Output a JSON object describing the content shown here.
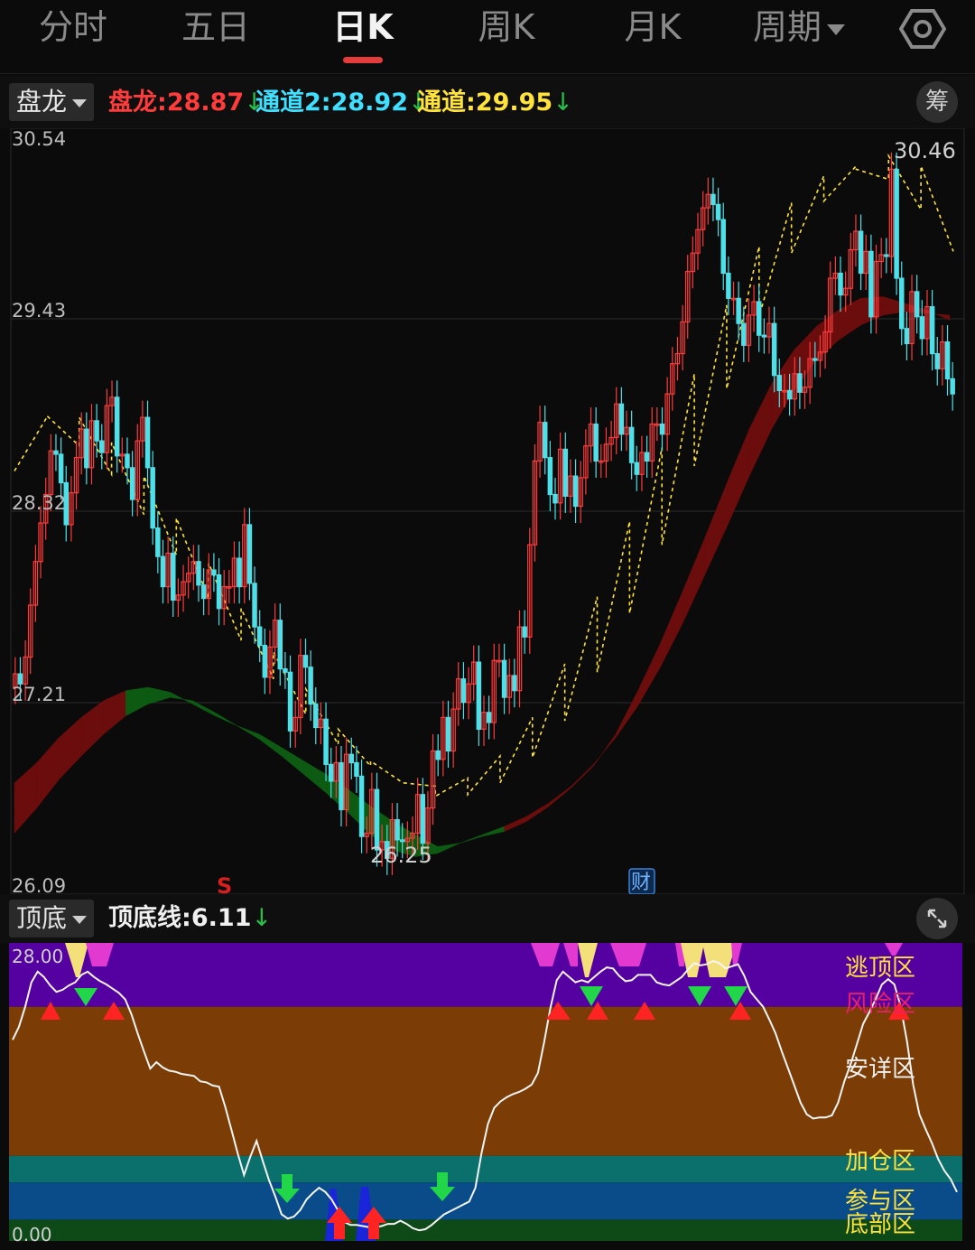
{
  "tabs": [
    {
      "label": "分时",
      "active": false
    },
    {
      "label": "五日",
      "active": false
    },
    {
      "label": "日K",
      "active": true
    },
    {
      "label": "周K",
      "active": false
    },
    {
      "label": "月K",
      "active": false
    },
    {
      "label": "周期",
      "active": false,
      "dropdown": true
    }
  ],
  "settings_icon": "gear-icon",
  "main_indicator": {
    "selector_label": "盘龙",
    "legend": [
      {
        "label": "盘龙:",
        "value": "28.87",
        "color": "#ff3b3b"
      },
      {
        "label": "通道2:",
        "value": "28.92",
        "color": "#3fe0ff"
      },
      {
        "label": "通道:",
        "value": "29.95",
        "color": "#ffe23a"
      }
    ],
    "trend_symbol": "↓",
    "chip_button": "筹"
  },
  "chart_data": [
    {
      "type": "candlestick",
      "y_ticks": [
        "30.54",
        "29.43",
        "28.32",
        "27.21",
        "26.09"
      ],
      "ylim": [
        26.09,
        30.54
      ],
      "annotations": {
        "high": "30.46",
        "low": "26.25",
        "signal": "S",
        "event": "财"
      },
      "colors": {
        "up": "#ff3b3b",
        "down": "#4ee0e8",
        "band_up": "#6b0d0d",
        "band_down": "#0d5a12",
        "ma": "#ffe23a"
      },
      "candles": [
        [
          27.27,
          27.35
        ],
        [
          27.35,
          27.29
        ],
        [
          27.29,
          27.45
        ],
        [
          27.45,
          27.76
        ],
        [
          27.76,
          28.02
        ],
        [
          28.02,
          28.25
        ],
        [
          28.25,
          28.42
        ],
        [
          28.42,
          28.68
        ],
        [
          28.68,
          28.66
        ],
        [
          28.66,
          28.49
        ],
        [
          28.49,
          28.24
        ],
        [
          28.24,
          28.43
        ],
        [
          28.43,
          28.64
        ],
        [
          28.64,
          28.81
        ],
        [
          28.81,
          28.58
        ],
        [
          28.58,
          28.86
        ],
        [
          28.86,
          28.74
        ],
        [
          28.74,
          28.67
        ],
        [
          28.67,
          28.95
        ],
        [
          28.95,
          29.0
        ],
        [
          29.0,
          28.65
        ],
        [
          28.65,
          28.66
        ],
        [
          28.66,
          28.58
        ],
        [
          28.58,
          28.39
        ],
        [
          28.39,
          28.74
        ],
        [
          28.74,
          28.88
        ],
        [
          28.88,
          28.58
        ],
        [
          28.58,
          28.22
        ],
        [
          28.22,
          28.05
        ],
        [
          28.05,
          27.87
        ],
        [
          27.87,
          28.07
        ],
        [
          28.07,
          27.79
        ],
        [
          27.79,
          27.82
        ],
        [
          27.82,
          27.9
        ],
        [
          27.9,
          27.95
        ],
        [
          27.95,
          28.02
        ],
        [
          28.02,
          27.88
        ],
        [
          27.88,
          27.8
        ],
        [
          27.8,
          27.97
        ],
        [
          27.97,
          27.94
        ],
        [
          27.94,
          27.74
        ],
        [
          27.74,
          27.87
        ],
        [
          27.87,
          27.87
        ],
        [
          27.87,
          28.04
        ],
        [
          28.04,
          27.87
        ],
        [
          27.87,
          28.24
        ],
        [
          28.24,
          27.89
        ],
        [
          27.89,
          27.63
        ],
        [
          27.63,
          27.52
        ],
        [
          27.52,
          27.33
        ],
        [
          27.33,
          27.51
        ],
        [
          27.51,
          27.67
        ],
        [
          27.67,
          27.38
        ],
        [
          27.38,
          27.36
        ],
        [
          27.36,
          27.01
        ],
        [
          27.01,
          27.09
        ],
        [
          27.09,
          27.46
        ],
        [
          27.46,
          27.39
        ],
        [
          27.39,
          27.17
        ],
        [
          27.17,
          27.03
        ],
        [
          27.03,
          27.08
        ],
        [
          27.08,
          26.81
        ],
        [
          26.81,
          26.71
        ],
        [
          26.71,
          26.82
        ],
        [
          26.82,
          26.54
        ],
        [
          26.54,
          26.87
        ],
        [
          26.87,
          26.82
        ],
        [
          26.82,
          26.74
        ],
        [
          26.74,
          26.38
        ],
        [
          26.38,
          26.4
        ],
        [
          26.4,
          26.66
        ],
        [
          26.66,
          26.3
        ],
        [
          26.3,
          26.35
        ],
        [
          26.35,
          26.25
        ],
        [
          26.25,
          26.48
        ],
        [
          26.48,
          26.36
        ],
        [
          26.36,
          26.35
        ],
        [
          26.35,
          26.37
        ],
        [
          26.37,
          26.4
        ],
        [
          26.4,
          26.63
        ],
        [
          26.63,
          26.34
        ],
        [
          26.34,
          26.55
        ],
        [
          26.55,
          26.89
        ],
        [
          26.89,
          26.84
        ],
        [
          26.84,
          27.09
        ],
        [
          27.09,
          26.89
        ],
        [
          26.89,
          27.14
        ],
        [
          27.14,
          27.32
        ],
        [
          27.32,
          27.18
        ],
        [
          27.18,
          27.29
        ],
        [
          27.29,
          27.42
        ],
        [
          27.42,
          27.02
        ],
        [
          27.02,
          27.12
        ],
        [
          27.12,
          27.06
        ],
        [
          27.06,
          27.43
        ],
        [
          27.43,
          27.43
        ],
        [
          27.43,
          27.21
        ],
        [
          27.21,
          27.34
        ],
        [
          27.34,
          27.25
        ],
        [
          27.25,
          27.63
        ],
        [
          27.63,
          27.57
        ],
        [
          27.57,
          28.12
        ],
        [
          28.12,
          28.62
        ],
        [
          28.62,
          28.85
        ],
        [
          28.85,
          28.64
        ],
        [
          28.64,
          28.42
        ],
        [
          28.42,
          28.37
        ],
        [
          28.37,
          28.69
        ],
        [
          28.69,
          28.41
        ],
        [
          28.41,
          28.53
        ],
        [
          28.53,
          28.35
        ],
        [
          28.35,
          28.52
        ],
        [
          28.52,
          28.71
        ],
        [
          28.71,
          28.84
        ],
        [
          28.84,
          28.62
        ],
        [
          28.62,
          28.62
        ],
        [
          28.62,
          28.72
        ],
        [
          28.72,
          28.76
        ],
        [
          28.76,
          28.96
        ],
        [
          28.96,
          28.78
        ],
        [
          28.78,
          28.82
        ],
        [
          28.82,
          28.61
        ],
        [
          28.61,
          28.54
        ],
        [
          28.54,
          28.67
        ],
        [
          28.67,
          28.62
        ],
        [
          28.62,
          28.84
        ],
        [
          28.84,
          28.84
        ],
        [
          28.84,
          28.78
        ],
        [
          28.78,
          29.02
        ],
        [
          29.02,
          29.2
        ],
        [
          29.2,
          29.26
        ],
        [
          29.26,
          29.45
        ],
        [
          29.45,
          29.75
        ],
        [
          29.75,
          29.86
        ],
        [
          29.86,
          30.0
        ],
        [
          30.0,
          30.13
        ],
        [
          30.13,
          30.21
        ],
        [
          30.21,
          30.15
        ],
        [
          30.15,
          30.06
        ],
        [
          30.06,
          29.74
        ],
        [
          29.74,
          29.59
        ],
        [
          29.59,
          29.59
        ],
        [
          29.59,
          29.44
        ],
        [
          29.44,
          29.31
        ],
        [
          29.31,
          29.49
        ],
        [
          29.49,
          29.57
        ],
        [
          29.57,
          29.37
        ],
        [
          29.37,
          29.36
        ],
        [
          29.36,
          29.44
        ],
        [
          29.44,
          29.13
        ],
        [
          29.13,
          29.04
        ],
        [
          29.04,
          29.04
        ],
        [
          29.04,
          28.99
        ],
        [
          28.99,
          29.14
        ],
        [
          29.14,
          29.03
        ],
        [
          29.03,
          29.06
        ],
        [
          29.06,
          29.23
        ],
        [
          29.23,
          29.22
        ],
        [
          29.22,
          29.27
        ],
        [
          29.27,
          29.39
        ],
        [
          29.39,
          29.71
        ],
        [
          29.71,
          29.74
        ],
        [
          29.74,
          29.61
        ],
        [
          29.61,
          29.65
        ],
        [
          29.65,
          29.88
        ],
        [
          29.88,
          29.99
        ],
        [
          29.99,
          29.74
        ],
        [
          29.74,
          29.87
        ],
        [
          29.87,
          29.48
        ],
        [
          29.48,
          29.81
        ],
        [
          29.81,
          29.85
        ],
        [
          29.85,
          29.84
        ],
        [
          29.84,
          30.36
        ],
        [
          30.36,
          29.71
        ],
        [
          29.71,
          29.41
        ],
        [
          29.41,
          29.32
        ],
        [
          29.32,
          29.63
        ],
        [
          29.63,
          29.48
        ],
        [
          29.48,
          29.35
        ],
        [
          29.35,
          29.54
        ],
        [
          29.54,
          29.26
        ],
        [
          29.26,
          29.17
        ],
        [
          29.17,
          29.33
        ],
        [
          29.33,
          29.11
        ],
        [
          29.11,
          29.02
        ]
      ],
      "ma_curve": [
        [
          28.56,
          28.88
        ],
        [
          28.89,
          28.71
        ],
        [
          28.88,
          28.54
        ],
        [
          28.73,
          28.3
        ],
        [
          28.53,
          28.06
        ],
        [
          28.28,
          27.8
        ],
        [
          28.01,
          27.55
        ],
        [
          27.74,
          27.32
        ],
        [
          27.48,
          27.11
        ],
        [
          27.26,
          26.93
        ],
        [
          27.02,
          26.8
        ],
        [
          26.83,
          26.7
        ],
        [
          26.7,
          26.68
        ],
        [
          26.62,
          26.73
        ],
        [
          26.63,
          26.86
        ],
        [
          26.7,
          27.09
        ],
        [
          26.85,
          27.41
        ],
        [
          27.07,
          27.81
        ],
        [
          27.36,
          28.26
        ],
        [
          27.71,
          28.7
        ],
        [
          28.12,
          29.14
        ],
        [
          28.59,
          29.55
        ],
        [
          29.05,
          29.9
        ],
        [
          29.48,
          30.16
        ],
        [
          29.86,
          30.32
        ],
        [
          30.17,
          30.38
        ],
        [
          30.36,
          30.3
        ],
        [
          30.44,
          30.12
        ],
        [
          30.38,
          29.87
        ]
      ],
      "band_upper": [
        26.7,
        26.82,
        26.97,
        27.09,
        27.19,
        27.25,
        27.27,
        27.24,
        27.17,
        27.1,
        27.04,
        26.99,
        26.91,
        26.83,
        26.75,
        26.66,
        26.56,
        26.47,
        26.39,
        26.32,
        26.34,
        26.38,
        26.41,
        26.47,
        26.56,
        26.67,
        26.8,
        26.99,
        27.25,
        27.53,
        27.84,
        28.16,
        28.49,
        28.81,
        29.08,
        29.28,
        29.42,
        29.52,
        29.59,
        29.6,
        29.56,
        29.52,
        29.46
      ],
      "band_lower": [
        26.4,
        26.55,
        26.72,
        26.86,
        26.99,
        27.1,
        27.17,
        27.21,
        27.19,
        27.12,
        27.04,
        26.96,
        26.86,
        26.75,
        26.64,
        26.52,
        26.39,
        26.3,
        26.26,
        26.28,
        26.34,
        26.39,
        26.44,
        26.5,
        26.58,
        26.68,
        26.81,
        26.97,
        27.16,
        27.39,
        27.65,
        27.94,
        28.23,
        28.53,
        28.81,
        29.04,
        29.22,
        29.34,
        29.43,
        29.49,
        29.51,
        29.5,
        29.49
      ]
    },
    {
      "type": "line",
      "series": [
        {
          "name": "顶底线",
          "values": [
            18.9,
            20.1,
            22.0,
            24.3,
            25.3,
            24.8,
            24.0,
            23.4,
            23.6,
            24.0,
            24.3,
            25.0,
            25.3,
            24.8,
            24.4,
            24.1,
            23.7,
            23.3,
            22.7,
            21.3,
            19.5,
            17.8,
            16.2,
            16.8,
            16.3,
            16.0,
            15.9,
            15.7,
            15.6,
            15.5,
            15.0,
            14.9,
            14.6,
            14.5,
            12.6,
            10.4,
            8.2,
            6.2,
            7.9,
            9.4,
            7.5,
            5.7,
            4.2,
            2.5,
            2.1,
            2.3,
            2.9,
            3.9,
            4.5,
            5.0,
            4.6,
            3.9,
            2.9,
            1.8,
            1.5,
            1.5,
            1.4,
            1.3,
            1.3,
            1.4,
            1.6,
            1.6,
            1.9,
            1.6,
            1.2,
            1.0,
            1.1,
            1.5,
            2.0,
            2.5,
            2.8,
            3.1,
            3.4,
            3.7,
            5.0,
            8.3,
            11.0,
            12.5,
            13.1,
            13.5,
            13.8,
            14.0,
            14.3,
            14.7,
            15.8,
            18.7,
            21.9,
            24.5,
            25.3,
            24.8,
            24.3,
            24.5,
            24.3,
            24.8,
            25.3,
            25.7,
            25.6,
            24.9,
            24.4,
            24.5,
            25.0,
            25.0,
            25.0,
            24.3,
            24.1,
            24.0,
            24.4,
            24.8,
            25.5,
            26.1,
            25.9,
            26.0,
            26.3,
            26.1,
            25.6,
            25.8,
            26.0,
            24.9,
            23.4,
            22.7,
            22.0,
            20.8,
            19.5,
            17.8,
            16.2,
            14.6,
            13.0,
            11.9,
            11.5,
            11.6,
            11.6,
            11.8,
            13.0,
            15.0,
            16.6,
            18.5,
            20.4,
            21.5,
            22.7,
            24.1,
            24.6,
            24.1,
            22.0,
            18.8,
            14.7,
            11.9,
            10.5,
            9.2,
            7.7,
            6.6,
            5.8,
            4.6
          ]
        }
      ],
      "y_ticks": [
        "28.00",
        "0.00"
      ],
      "ylim": [
        0,
        28
      ],
      "zones": [
        {
          "label": "逃顶区",
          "from": 22.0,
          "to": 28.0,
          "color": "#5500a0",
          "label_color": "#ffe23a"
        },
        {
          "label": "风险区",
          "from": 22.0,
          "to": 28.0,
          "color": "#5500a0",
          "label_color": "#e8206a"
        },
        {
          "label": "安详区",
          "from": 8.0,
          "to": 22.0,
          "color": "#7b3d05",
          "label_color": "#f0f0f0"
        },
        {
          "label": "加仓区",
          "from": 5.5,
          "to": 8.0,
          "color": "#0b6f6b",
          "label_color": "#ffe23a"
        },
        {
          "label": "参与区",
          "from": 2.0,
          "to": 5.5,
          "color": "#0a4c8a",
          "label_color": "#ffe23a"
        },
        {
          "label": "底部区",
          "from": 0.0,
          "to": 2.0,
          "color": "#0d4a17",
          "label_color": "#ffe23a"
        }
      ]
    }
  ],
  "sub_indicator": {
    "selector_label": "顶底",
    "legend": [
      {
        "label": "顶底线:",
        "value": "6.11",
        "color": "#f0f0f0"
      }
    ],
    "trend_symbol": "↓",
    "expand_icon": "expand-icon"
  }
}
